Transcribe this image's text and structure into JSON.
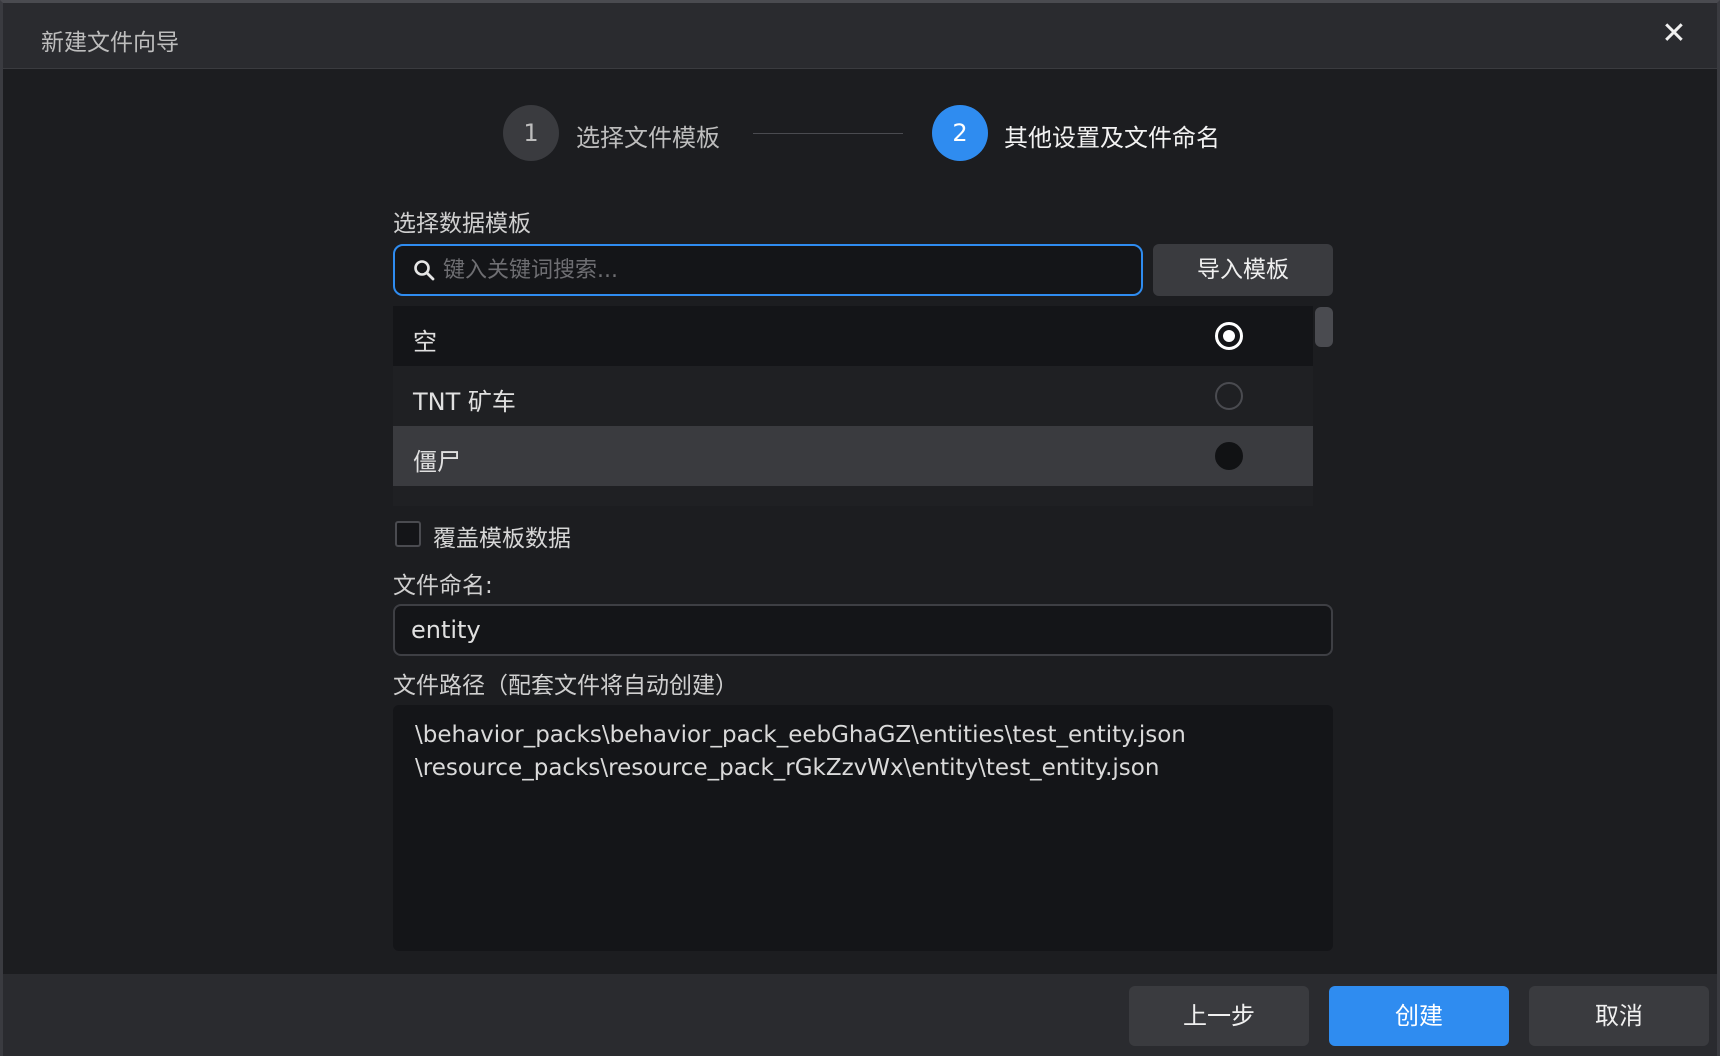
{
  "window": {
    "title": "新建文件向导",
    "close_icon": "close-icon"
  },
  "steps": [
    {
      "number": "1",
      "label": "选择文件模板",
      "state": "done"
    },
    {
      "number": "2",
      "label": "其他设置及文件命名",
      "state": "active"
    }
  ],
  "template_section": {
    "label": "选择数据模板",
    "search_placeholder": "键入关键词搜索...",
    "search_value": "",
    "import_button": "导入模板",
    "items": [
      {
        "name": "空",
        "selected": true
      },
      {
        "name": "TNT 矿车",
        "selected": false
      },
      {
        "name": "僵尸",
        "selected": false
      }
    ]
  },
  "override": {
    "label": "覆盖模板数据",
    "checked": false
  },
  "file_name": {
    "label": "文件命名:",
    "value": "entity"
  },
  "file_path": {
    "label": "文件路径（配套文件将自动创建）",
    "lines": [
      "\\behavior_packs\\behavior_pack_eebGhaGZ\\entities\\test_entity.json",
      "\\resource_packs\\resource_pack_rGkZzvWx\\entity\\test_entity.json"
    ]
  },
  "footer": {
    "prev": "上一步",
    "create": "创建",
    "cancel": "取消"
  },
  "colors": {
    "accent": "#2f8cf0",
    "background": "#1c1d20",
    "panel": "#2a2b2f"
  }
}
